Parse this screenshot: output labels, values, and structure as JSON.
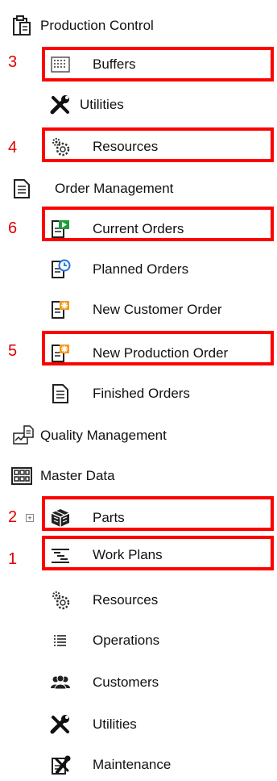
{
  "tree": {
    "production_control": {
      "label": "Production Control",
      "icon": "clipboard-icon"
    },
    "buffers": {
      "label": "Buffers",
      "icon": "grid-icon"
    },
    "utilities_1": {
      "label": "Utilities",
      "icon": "wrench-screwdriver-icon"
    },
    "resources_1": {
      "label": "Resources",
      "icon": "gears-icon"
    },
    "order_management": {
      "label": "Order Management",
      "icon": "document-icon"
    },
    "current_orders": {
      "label": "Current Orders",
      "icon": "current-orders-icon"
    },
    "planned_orders": {
      "label": "Planned Orders",
      "icon": "planned-orders-icon"
    },
    "new_customer_order": {
      "label": "New Customer Order",
      "icon": "new-order-icon"
    },
    "new_production_order": {
      "label": "New Production Order",
      "icon": "new-order-icon"
    },
    "finished_orders": {
      "label": "Finished Orders",
      "icon": "document-icon"
    },
    "quality_management": {
      "label": "Quality Management",
      "icon": "quality-chart-icon"
    },
    "master_data": {
      "label": "Master Data",
      "icon": "table-grid-icon"
    },
    "parts": {
      "label": "Parts",
      "icon": "parts-box-icon",
      "expander": "+"
    },
    "work_plans": {
      "label": "Work Plans",
      "icon": "work-plan-icon"
    },
    "resources_2": {
      "label": "Resources",
      "icon": "gears-icon"
    },
    "operations": {
      "label": "Operations",
      "icon": "list-icon"
    },
    "customers": {
      "label": "Customers",
      "icon": "people-icon"
    },
    "utilities_2": {
      "label": "Utilities",
      "icon": "wrench-screwdriver-icon"
    },
    "maintenance": {
      "label": "Maintenance",
      "icon": "maintenance-icon"
    }
  },
  "annotations": [
    "3",
    "4",
    "6",
    "5",
    "2",
    "1"
  ],
  "colors": {
    "highlight": "#ff0000",
    "annotation": "#e00000"
  }
}
